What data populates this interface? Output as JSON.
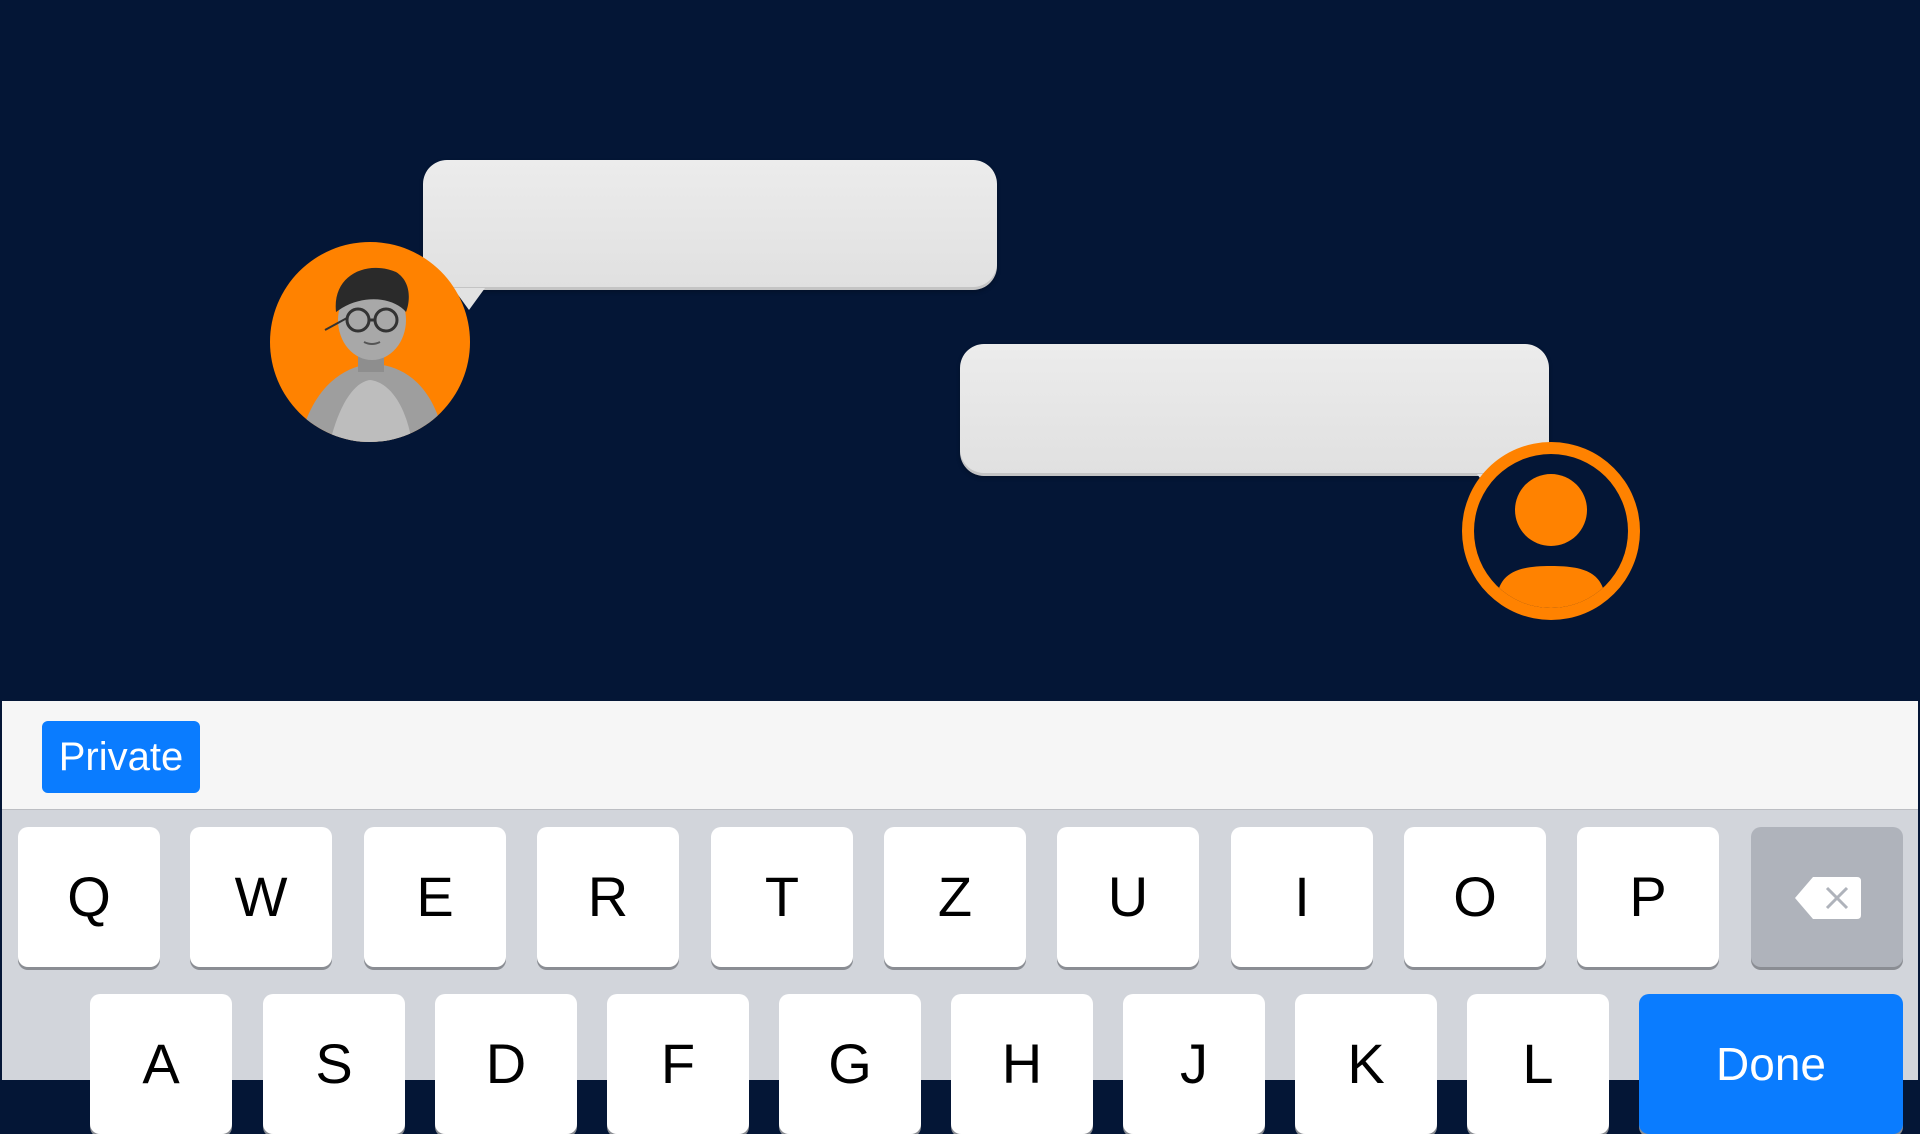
{
  "suggestion_bar": {
    "private_label": "Private"
  },
  "keyboard": {
    "row1": [
      "Q",
      "W",
      "E",
      "R",
      "T",
      "Z",
      "U",
      "I",
      "O",
      "P"
    ],
    "row2": [
      "A",
      "S",
      "D",
      "F",
      "G",
      "H",
      "J",
      "K",
      "L"
    ],
    "done_label": "Done",
    "backspace_icon": "backspace-icon"
  },
  "colors": {
    "background": "#041636",
    "accent_orange": "#ff8200",
    "bubble": "#e2e2e2",
    "keyboard_blue": "#0a7cff"
  }
}
